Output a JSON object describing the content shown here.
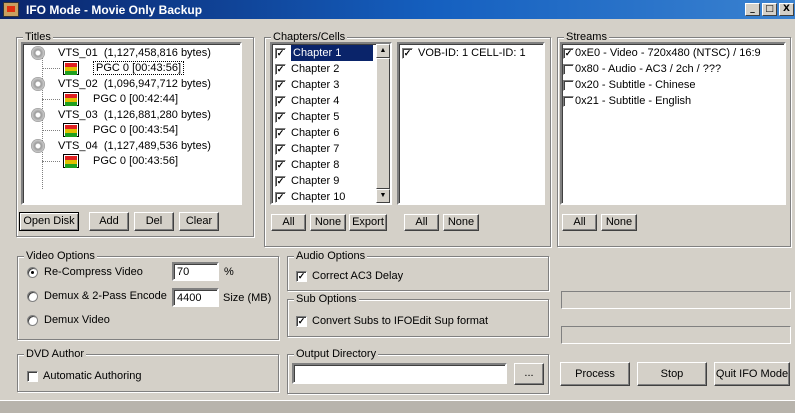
{
  "window": {
    "title": "IFO Mode - Movie Only Backup",
    "buttons": [
      "_",
      "□",
      "X"
    ]
  },
  "titles": {
    "label": "Titles",
    "items": [
      {
        "vts": "VTS_01",
        "size": "(1,127,458,816 bytes)",
        "pgc": "PGC 0 [00:43:56]"
      },
      {
        "vts": "VTS_02",
        "size": "(1,096,947,712 bytes)",
        "pgc": "PGC 0 [00:42:44]"
      },
      {
        "vts": "VTS_03",
        "size": "(1,126,881,280 bytes)",
        "pgc": "PGC 0 [00:43:54]"
      },
      {
        "vts": "VTS_04",
        "size": "(1,127,489,536 bytes)",
        "pgc": "PGC 0 [00:43:56]"
      }
    ],
    "buttons": {
      "open_disk": "Open Disk",
      "add": "Add",
      "del": "Del",
      "clear": "Clear"
    }
  },
  "chapters": {
    "label": "Chapters/Cells",
    "items": [
      "Chapter 1",
      "Chapter 2",
      "Chapter 3",
      "Chapter 4",
      "Chapter 5",
      "Chapter 6",
      "Chapter 7",
      "Chapter 8",
      "Chapter 9",
      "Chapter 10"
    ],
    "cells": [
      "VOB-ID: 1 CELL-ID: 1"
    ],
    "buttons": {
      "all": "All",
      "none": "None",
      "export": "Export",
      "cells_all": "All",
      "cells_none": "None"
    }
  },
  "streams": {
    "label": "Streams",
    "items": [
      {
        "text": "0xE0 - Video - 720x480 (NTSC) / 16:9",
        "checked": true
      },
      {
        "text": "0x80 - Audio - AC3 / 2ch / ???",
        "checked": false
      },
      {
        "text": "0x20 - Subtitle - Chinese",
        "checked": false
      },
      {
        "text": "0x21 - Subtitle - English",
        "checked": false
      }
    ],
    "buttons": {
      "all": "All",
      "none": "None"
    }
  },
  "video_options": {
    "label": "Video Options",
    "recompress": "Re-Compress Video",
    "recompress_value": "70",
    "percent": "%",
    "demux2pass": "Demux & 2-Pass Encode",
    "size_value": "4400",
    "size_unit": "Size (MB)",
    "demux": "Demux Video"
  },
  "audio_options": {
    "label": "Audio Options",
    "correct_ac3": "Correct AC3 Delay"
  },
  "sub_options": {
    "label": "Sub Options",
    "convert_subs": "Convert Subs to IFOEdit Sup format"
  },
  "dvd_author": {
    "label": "DVD Author",
    "auto_authoring": "Automatic Authoring"
  },
  "output": {
    "label": "Output Directory",
    "value": "",
    "browse": "..."
  },
  "actions": {
    "process": "Process",
    "stop": "Stop",
    "quit": "Quit IFO Mode"
  }
}
